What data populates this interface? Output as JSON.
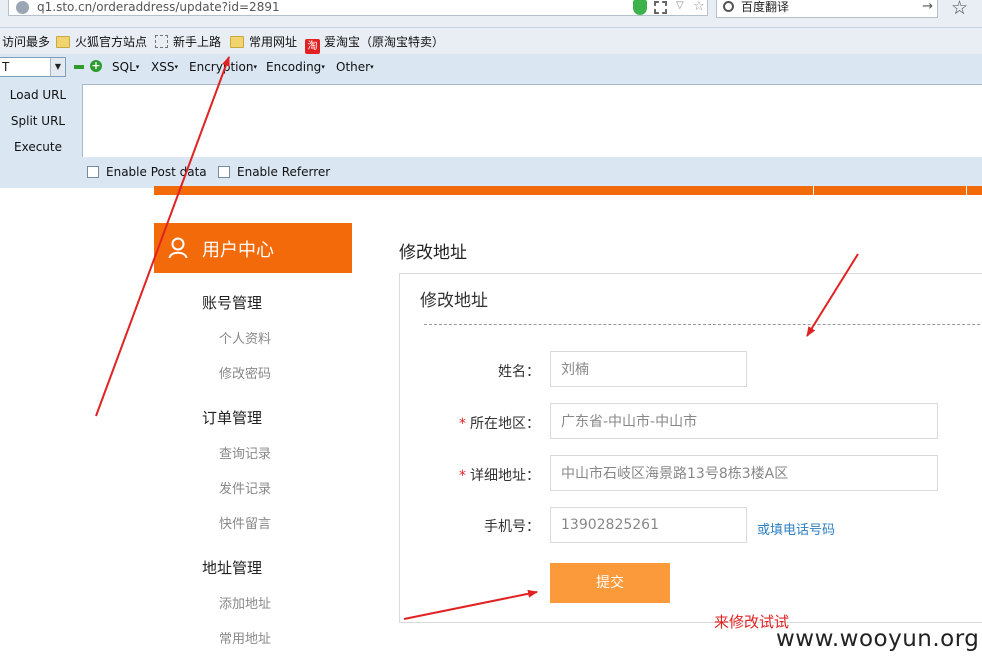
{
  "browser": {
    "url": "q1.sto.cn/orderaddress/update?id=2891",
    "search_value": "百度翻译",
    "bookmarks": [
      {
        "label": "访问最多",
        "icon": "none"
      },
      {
        "label": "火狐官方站点",
        "icon": "folder-icon"
      },
      {
        "label": "新手上路",
        "icon": "dashed-page-icon"
      },
      {
        "label": "常用网址",
        "icon": "folder-icon"
      },
      {
        "label": "爱淘宝（原淘宝特卖）",
        "icon": "taobao-icon"
      }
    ]
  },
  "hackbar": {
    "select_value": "T",
    "menus": [
      "SQL",
      "XSS",
      "Encryption",
      "Encoding",
      "Other"
    ],
    "actions": [
      "Load URL",
      "Split URL",
      "Execute"
    ],
    "checkboxes": [
      "Enable Post data",
      "Enable Referrer"
    ]
  },
  "sidebar": {
    "header": "用户中心",
    "groups": [
      {
        "title": "账号管理",
        "items": [
          "个人资料",
          "修改密码"
        ]
      },
      {
        "title": "订单管理",
        "items": [
          "查询记录",
          "发件记录",
          "快件留言"
        ]
      },
      {
        "title": "地址管理",
        "items": [
          "添加地址",
          "常用地址"
        ]
      }
    ]
  },
  "main": {
    "page_title": "修改地址",
    "panel_title": "修改地址",
    "form": {
      "name_label": "姓名：",
      "name_value": "刘楠",
      "region_label": "所在地区：",
      "region_value": "广东省-中山市-中山市",
      "address_label": "详细地址：",
      "address_value": "中山市石岐区海景路13号8栋3楼A区",
      "phone_label": "手机号：",
      "phone_value": "13902825261",
      "phone_alt_link": "或填电话号码",
      "submit_label": "提交"
    }
  },
  "annotation": "来修改试试",
  "watermark": "www.wooyun.org",
  "colors": {
    "accent": "#f26a0a",
    "submit": "#fa9a3a",
    "annotation": "#e02222",
    "link": "#2d7fc4"
  }
}
